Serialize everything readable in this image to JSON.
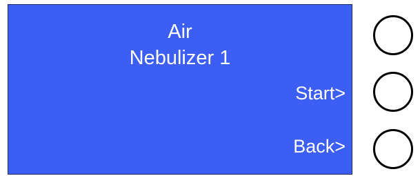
{
  "display": {
    "title_line_1": "Air",
    "title_line_2": "Nebulizer 1",
    "start_label": "Start>",
    "back_label": "Back>"
  },
  "colors": {
    "screen_background": "#3c5ef2",
    "text": "#ffffff",
    "button_border": "#000000"
  }
}
